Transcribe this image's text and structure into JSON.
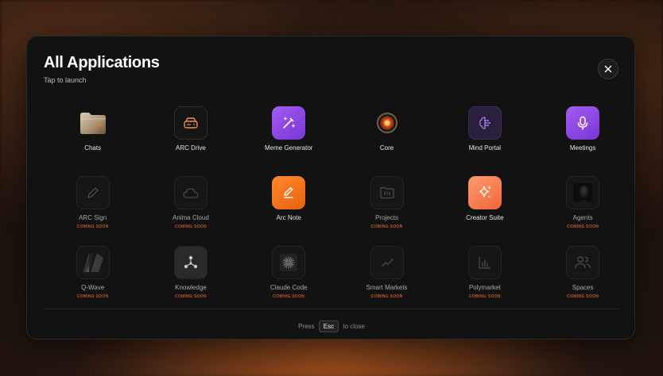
{
  "modal": {
    "title": "All Applications",
    "subtitle": "Tap to launch",
    "close_icon": "close-icon"
  },
  "apps": [
    {
      "label": "Chats",
      "icon": "folder-icon",
      "coming_soon": ""
    },
    {
      "label": "ARC Drive",
      "icon": "drive-icon",
      "coming_soon": ""
    },
    {
      "label": "Meme Generator",
      "icon": "magic-wand-icon",
      "coming_soon": ""
    },
    {
      "label": "Core",
      "icon": "core-orb-icon",
      "coming_soon": ""
    },
    {
      "label": "Mind Portal",
      "icon": "brain-icon",
      "coming_soon": ""
    },
    {
      "label": "Meetings",
      "icon": "microphone-icon",
      "coming_soon": ""
    },
    {
      "label": "ARC Sign",
      "icon": "pen-icon",
      "coming_soon": "COMING SOON"
    },
    {
      "label": "Anima Cloud",
      "icon": "cloud-icon",
      "coming_soon": "COMING SOON"
    },
    {
      "label": "Arc Note",
      "icon": "note-pen-icon",
      "coming_soon": ""
    },
    {
      "label": "Projects",
      "icon": "projects-folder-icon",
      "coming_soon": "COMING SOON"
    },
    {
      "label": "Creator Suite",
      "icon": "sparkle-icon",
      "coming_soon": ""
    },
    {
      "label": "Agents",
      "icon": "agent-avatar-icon",
      "coming_soon": "COMING SOON"
    },
    {
      "label": "Q-Wave",
      "icon": "q-wave-icon",
      "coming_soon": "COMING SOON"
    },
    {
      "label": "Knowledge",
      "icon": "knowledge-graph-icon",
      "coming_soon": "COMING SOON"
    },
    {
      "label": "Claude Code",
      "icon": "claude-burst-icon",
      "coming_soon": "COMING SOON"
    },
    {
      "label": "Smart Markets",
      "icon": "trend-line-icon",
      "coming_soon": "COMING SOON"
    },
    {
      "label": "Polymarket",
      "icon": "bar-chart-icon",
      "coming_soon": "COMING SOON"
    },
    {
      "label": "Spaces",
      "icon": "users-icon",
      "coming_soon": "COMING SOON"
    }
  ],
  "footer": {
    "press": "Press",
    "key": "Esc",
    "to_close": "to close"
  }
}
